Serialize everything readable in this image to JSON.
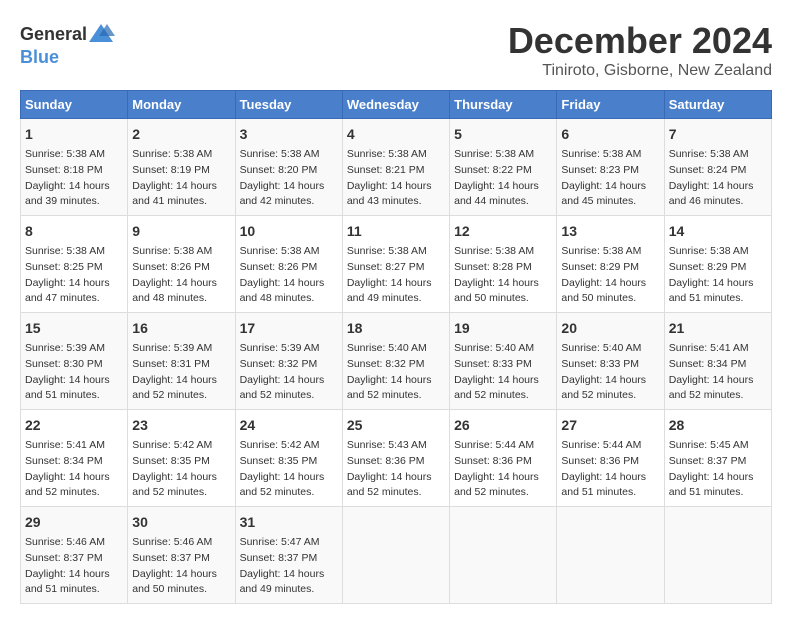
{
  "logo": {
    "general": "General",
    "blue": "Blue"
  },
  "title": "December 2024",
  "location": "Tiniroto, Gisborne, New Zealand",
  "days_of_week": [
    "Sunday",
    "Monday",
    "Tuesday",
    "Wednesday",
    "Thursday",
    "Friday",
    "Saturday"
  ],
  "weeks": [
    [
      {
        "day": "1",
        "info": "Sunrise: 5:38 AM\nSunset: 8:18 PM\nDaylight: 14 hours\nand 39 minutes."
      },
      {
        "day": "2",
        "info": "Sunrise: 5:38 AM\nSunset: 8:19 PM\nDaylight: 14 hours\nand 41 minutes."
      },
      {
        "day": "3",
        "info": "Sunrise: 5:38 AM\nSunset: 8:20 PM\nDaylight: 14 hours\nand 42 minutes."
      },
      {
        "day": "4",
        "info": "Sunrise: 5:38 AM\nSunset: 8:21 PM\nDaylight: 14 hours\nand 43 minutes."
      },
      {
        "day": "5",
        "info": "Sunrise: 5:38 AM\nSunset: 8:22 PM\nDaylight: 14 hours\nand 44 minutes."
      },
      {
        "day": "6",
        "info": "Sunrise: 5:38 AM\nSunset: 8:23 PM\nDaylight: 14 hours\nand 45 minutes."
      },
      {
        "day": "7",
        "info": "Sunrise: 5:38 AM\nSunset: 8:24 PM\nDaylight: 14 hours\nand 46 minutes."
      }
    ],
    [
      {
        "day": "8",
        "info": "Sunrise: 5:38 AM\nSunset: 8:25 PM\nDaylight: 14 hours\nand 47 minutes."
      },
      {
        "day": "9",
        "info": "Sunrise: 5:38 AM\nSunset: 8:26 PM\nDaylight: 14 hours\nand 48 minutes."
      },
      {
        "day": "10",
        "info": "Sunrise: 5:38 AM\nSunset: 8:26 PM\nDaylight: 14 hours\nand 48 minutes."
      },
      {
        "day": "11",
        "info": "Sunrise: 5:38 AM\nSunset: 8:27 PM\nDaylight: 14 hours\nand 49 minutes."
      },
      {
        "day": "12",
        "info": "Sunrise: 5:38 AM\nSunset: 8:28 PM\nDaylight: 14 hours\nand 50 minutes."
      },
      {
        "day": "13",
        "info": "Sunrise: 5:38 AM\nSunset: 8:29 PM\nDaylight: 14 hours\nand 50 minutes."
      },
      {
        "day": "14",
        "info": "Sunrise: 5:38 AM\nSunset: 8:29 PM\nDaylight: 14 hours\nand 51 minutes."
      }
    ],
    [
      {
        "day": "15",
        "info": "Sunrise: 5:39 AM\nSunset: 8:30 PM\nDaylight: 14 hours\nand 51 minutes."
      },
      {
        "day": "16",
        "info": "Sunrise: 5:39 AM\nSunset: 8:31 PM\nDaylight: 14 hours\nand 52 minutes."
      },
      {
        "day": "17",
        "info": "Sunrise: 5:39 AM\nSunset: 8:32 PM\nDaylight: 14 hours\nand 52 minutes."
      },
      {
        "day": "18",
        "info": "Sunrise: 5:40 AM\nSunset: 8:32 PM\nDaylight: 14 hours\nand 52 minutes."
      },
      {
        "day": "19",
        "info": "Sunrise: 5:40 AM\nSunset: 8:33 PM\nDaylight: 14 hours\nand 52 minutes."
      },
      {
        "day": "20",
        "info": "Sunrise: 5:40 AM\nSunset: 8:33 PM\nDaylight: 14 hours\nand 52 minutes."
      },
      {
        "day": "21",
        "info": "Sunrise: 5:41 AM\nSunset: 8:34 PM\nDaylight: 14 hours\nand 52 minutes."
      }
    ],
    [
      {
        "day": "22",
        "info": "Sunrise: 5:41 AM\nSunset: 8:34 PM\nDaylight: 14 hours\nand 52 minutes."
      },
      {
        "day": "23",
        "info": "Sunrise: 5:42 AM\nSunset: 8:35 PM\nDaylight: 14 hours\nand 52 minutes."
      },
      {
        "day": "24",
        "info": "Sunrise: 5:42 AM\nSunset: 8:35 PM\nDaylight: 14 hours\nand 52 minutes."
      },
      {
        "day": "25",
        "info": "Sunrise: 5:43 AM\nSunset: 8:36 PM\nDaylight: 14 hours\nand 52 minutes."
      },
      {
        "day": "26",
        "info": "Sunrise: 5:44 AM\nSunset: 8:36 PM\nDaylight: 14 hours\nand 52 minutes."
      },
      {
        "day": "27",
        "info": "Sunrise: 5:44 AM\nSunset: 8:36 PM\nDaylight: 14 hours\nand 51 minutes."
      },
      {
        "day": "28",
        "info": "Sunrise: 5:45 AM\nSunset: 8:37 PM\nDaylight: 14 hours\nand 51 minutes."
      }
    ],
    [
      {
        "day": "29",
        "info": "Sunrise: 5:46 AM\nSunset: 8:37 PM\nDaylight: 14 hours\nand 51 minutes."
      },
      {
        "day": "30",
        "info": "Sunrise: 5:46 AM\nSunset: 8:37 PM\nDaylight: 14 hours\nand 50 minutes."
      },
      {
        "day": "31",
        "info": "Sunrise: 5:47 AM\nSunset: 8:37 PM\nDaylight: 14 hours\nand 49 minutes."
      },
      {
        "day": "",
        "info": ""
      },
      {
        "day": "",
        "info": ""
      },
      {
        "day": "",
        "info": ""
      },
      {
        "day": "",
        "info": ""
      }
    ]
  ]
}
